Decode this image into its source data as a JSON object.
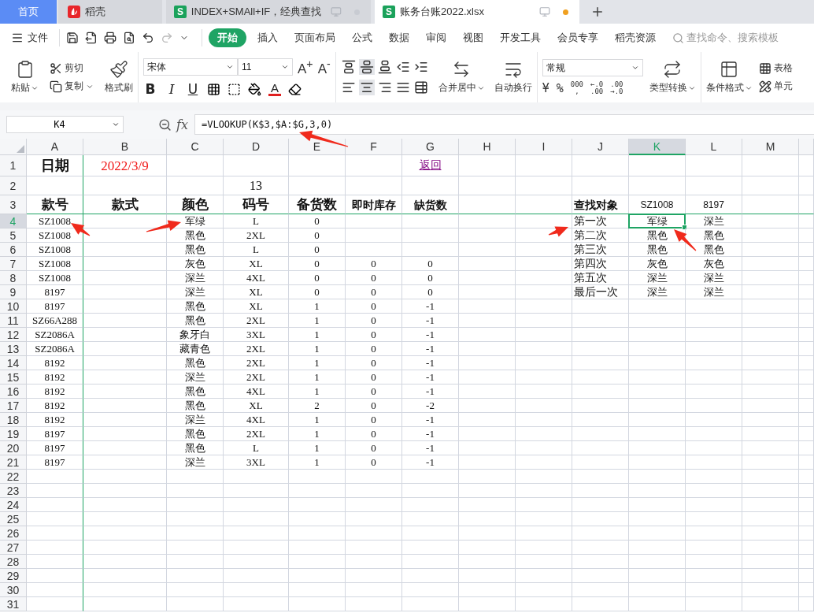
{
  "tabs": [
    {
      "kind": "home",
      "label": "首页",
      "selected": false
    },
    {
      "kind": "app",
      "label": "稻壳",
      "selected": false
    },
    {
      "kind": "doc",
      "icon_letter": "S",
      "label": "INDEX+SMAll+IF，经典查找",
      "selected": false,
      "unsaved": false
    },
    {
      "kind": "doc",
      "icon_letter": "S",
      "label": "账务台账2022.xlsx",
      "selected": true,
      "unsaved": true
    }
  ],
  "menu": {
    "file": "文件",
    "tabs": [
      {
        "label": "开始",
        "selected": true
      },
      {
        "label": "插入",
        "selected": false
      },
      {
        "label": "页面布局",
        "selected": false
      },
      {
        "label": "公式",
        "selected": false
      },
      {
        "label": "数据",
        "selected": false
      },
      {
        "label": "审阅",
        "selected": false
      },
      {
        "label": "视图",
        "selected": false
      },
      {
        "label": "开发工具",
        "selected": false
      },
      {
        "label": "会员专享",
        "selected": false
      },
      {
        "label": "稻壳资源",
        "selected": false
      }
    ],
    "search": {
      "placeholder": "查找命令、搜索模板"
    }
  },
  "ribbon": {
    "paste": "粘贴",
    "cut": "剪切",
    "copy": "复制",
    "painter": "格式刷",
    "font": "宋体",
    "size": "11",
    "grow": "A$^{+}$",
    "shrink": "A$^{-}$",
    "styles": [
      {
        "kind": "bold",
        "label": "B"
      },
      {
        "kind": "italic",
        "label": "I"
      },
      {
        "kind": "underline",
        "label": "U"
      }
    ],
    "font_color": "A",
    "merge": "合并居中",
    "wrap": "自动换行",
    "number_format": "常规",
    "number_buttons": [
      {
        "kind": "single",
        "lines": [
          "¥"
        ]
      },
      {
        "kind": "single",
        "lines": [
          "%"
        ]
      },
      {
        "kind": "stack",
        "lines": [
          "000",
          ","
        ]
      },
      {
        "kind": "stack",
        "lines": [
          "←.0",
          ".00"
        ]
      },
      {
        "kind": "stack",
        "lines": [
          ".00",
          "→.0"
        ]
      }
    ],
    "convert": "类型转换",
    "conditional": "条件格式",
    "table_style": "表格",
    "cell_style": "单元"
  },
  "formula_bar": {
    "name_box": "K4",
    "fx": "fx",
    "formula": "=VLOOKUP(K$3,$A:$G,3,0)"
  },
  "sheet": {
    "columns": [
      {
        "label": "A",
        "selected": false
      },
      {
        "label": "B",
        "selected": false
      },
      {
        "label": "C",
        "selected": false
      },
      {
        "label": "D",
        "selected": false
      },
      {
        "label": "E",
        "selected": false
      },
      {
        "label": "F",
        "selected": false
      },
      {
        "label": "G",
        "selected": false
      },
      {
        "label": "H",
        "selected": false
      },
      {
        "label": "I",
        "selected": false
      },
      {
        "label": "J",
        "selected": false
      },
      {
        "label": "K",
        "selected": true
      },
      {
        "label": "L",
        "selected": false
      },
      {
        "label": "M",
        "selected": false
      }
    ],
    "rows": [
      {
        "label": "1",
        "selected": false,
        "cells": {
          "A": {
            "text": "日期",
            "kind": "title"
          },
          "B": {
            "text": "2022/3/9",
            "kind": "date"
          },
          "G": {
            "text": "返回",
            "kind": "link"
          }
        }
      },
      {
        "label": "2",
        "selected": false,
        "cells": {
          "D": {
            "text": "13",
            "kind": "large"
          }
        }
      },
      {
        "label": "3",
        "selected": false,
        "cells": {
          "A": {
            "text": "款号",
            "kind": "header"
          },
          "B": {
            "text": "款式",
            "kind": "header"
          },
          "C": {
            "text": "颜色",
            "kind": "header"
          },
          "D": {
            "text": "码号",
            "kind": "header"
          },
          "E": {
            "text": "备货数",
            "kind": "header"
          },
          "F": {
            "text": "即时库存",
            "kind": "header-small"
          },
          "G": {
            "text": "缺货数",
            "kind": "header-small"
          },
          "J": {
            "text": "查找对象",
            "kind": "label"
          },
          "K": {
            "text": "SZ1008",
            "kind": "sans"
          },
          "L": {
            "text": "8197",
            "kind": "sans"
          }
        }
      },
      {
        "label": "4",
        "selected": true,
        "cells": {
          "A": {
            "text": "SZ1008",
            "kind": "plain"
          },
          "C": {
            "text": "军绿",
            "kind": "plain"
          },
          "D": {
            "text": "L",
            "kind": "plain"
          },
          "E": {
            "text": "0",
            "kind": "plain"
          },
          "J": {
            "text": "第一次",
            "kind": "left"
          },
          "K": {
            "text": "军绿",
            "kind": "plain"
          },
          "L": {
            "text": "深兰",
            "kind": "plain"
          }
        }
      },
      {
        "label": "5",
        "selected": false,
        "cells": {
          "A": {
            "text": "SZ1008",
            "kind": "plain"
          },
          "C": {
            "text": "黑色",
            "kind": "plain"
          },
          "D": {
            "text": "2XL",
            "kind": "plain"
          },
          "E": {
            "text": "0",
            "kind": "plain"
          },
          "J": {
            "text": "第二次",
            "kind": "left"
          },
          "K": {
            "text": "黑色",
            "kind": "plain"
          },
          "L": {
            "text": "黑色",
            "kind": "plain"
          }
        }
      },
      {
        "label": "6",
        "selected": false,
        "cells": {
          "A": {
            "text": "SZ1008",
            "kind": "plain"
          },
          "C": {
            "text": "黑色",
            "kind": "plain"
          },
          "D": {
            "text": "L",
            "kind": "plain"
          },
          "E": {
            "text": "0",
            "kind": "plain"
          },
          "J": {
            "text": "第三次",
            "kind": "left"
          },
          "K": {
            "text": "黑色",
            "kind": "plain"
          },
          "L": {
            "text": "黑色",
            "kind": "plain"
          }
        }
      },
      {
        "label": "7",
        "selected": false,
        "cells": {
          "A": {
            "text": "SZ1008",
            "kind": "plain"
          },
          "C": {
            "text": "灰色",
            "kind": "plain"
          },
          "D": {
            "text": "XL",
            "kind": "plain"
          },
          "E": {
            "text": "0",
            "kind": "plain"
          },
          "F": {
            "text": "0",
            "kind": "plain"
          },
          "G": {
            "text": "0",
            "kind": "plain"
          },
          "J": {
            "text": "第四次",
            "kind": "left"
          },
          "K": {
            "text": "灰色",
            "kind": "plain"
          },
          "L": {
            "text": "灰色",
            "kind": "plain"
          }
        }
      },
      {
        "label": "8",
        "selected": false,
        "cells": {
          "A": {
            "text": "SZ1008",
            "kind": "plain"
          },
          "C": {
            "text": "深兰",
            "kind": "plain"
          },
          "D": {
            "text": "4XL",
            "kind": "plain"
          },
          "E": {
            "text": "0",
            "kind": "plain"
          },
          "F": {
            "text": "0",
            "kind": "plain"
          },
          "G": {
            "text": "0",
            "kind": "plain"
          },
          "J": {
            "text": "第五次",
            "kind": "left"
          },
          "K": {
            "text": "深兰",
            "kind": "plain"
          },
          "L": {
            "text": "深兰",
            "kind": "plain"
          }
        }
      },
      {
        "label": "9",
        "selected": false,
        "cells": {
          "A": {
            "text": "8197",
            "kind": "plain"
          },
          "C": {
            "text": "深兰",
            "kind": "plain"
          },
          "D": {
            "text": "XL",
            "kind": "plain"
          },
          "E": {
            "text": "0",
            "kind": "plain"
          },
          "F": {
            "text": "0",
            "kind": "plain"
          },
          "G": {
            "text": "0",
            "kind": "plain"
          },
          "J": {
            "text": "最后一次",
            "kind": "left"
          },
          "K": {
            "text": "深兰",
            "kind": "plain"
          },
          "L": {
            "text": "深兰",
            "kind": "plain"
          }
        }
      },
      {
        "label": "10",
        "selected": false,
        "cells": {
          "A": {
            "text": "8197",
            "kind": "plain"
          },
          "C": {
            "text": "黑色",
            "kind": "plain"
          },
          "D": {
            "text": "XL",
            "kind": "plain"
          },
          "E": {
            "text": "1",
            "kind": "plain"
          },
          "F": {
            "text": "0",
            "kind": "plain"
          },
          "G": {
            "text": "-1",
            "kind": "plain"
          }
        }
      },
      {
        "label": "11",
        "selected": false,
        "cells": {
          "A": {
            "text": "SZ66A288",
            "kind": "plain"
          },
          "C": {
            "text": "黑色",
            "kind": "plain"
          },
          "D": {
            "text": "2XL",
            "kind": "plain"
          },
          "E": {
            "text": "1",
            "kind": "plain"
          },
          "F": {
            "text": "0",
            "kind": "plain"
          },
          "G": {
            "text": "-1",
            "kind": "plain"
          }
        }
      },
      {
        "label": "12",
        "selected": false,
        "cells": {
          "A": {
            "text": "SZ2086A",
            "kind": "plain"
          },
          "C": {
            "text": "象牙白",
            "kind": "plain"
          },
          "D": {
            "text": "3XL",
            "kind": "plain"
          },
          "E": {
            "text": "1",
            "kind": "plain"
          },
          "F": {
            "text": "0",
            "kind": "plain"
          },
          "G": {
            "text": "-1",
            "kind": "plain"
          }
        }
      },
      {
        "label": "13",
        "selected": false,
        "cells": {
          "A": {
            "text": "SZ2086A",
            "kind": "plain"
          },
          "C": {
            "text": "藏青色",
            "kind": "plain"
          },
          "D": {
            "text": "2XL",
            "kind": "plain"
          },
          "E": {
            "text": "1",
            "kind": "plain"
          },
          "F": {
            "text": "0",
            "kind": "plain"
          },
          "G": {
            "text": "-1",
            "kind": "plain"
          }
        }
      },
      {
        "label": "14",
        "selected": false,
        "cells": {
          "A": {
            "text": "8192",
            "kind": "plain"
          },
          "C": {
            "text": "黑色",
            "kind": "plain"
          },
          "D": {
            "text": "2XL",
            "kind": "plain"
          },
          "E": {
            "text": "1",
            "kind": "plain"
          },
          "F": {
            "text": "0",
            "kind": "plain"
          },
          "G": {
            "text": "-1",
            "kind": "plain"
          }
        }
      },
      {
        "label": "15",
        "selected": false,
        "cells": {
          "A": {
            "text": "8192",
            "kind": "plain"
          },
          "C": {
            "text": "深兰",
            "kind": "plain"
          },
          "D": {
            "text": "2XL",
            "kind": "plain"
          },
          "E": {
            "text": "1",
            "kind": "plain"
          },
          "F": {
            "text": "0",
            "kind": "plain"
          },
          "G": {
            "text": "-1",
            "kind": "plain"
          }
        }
      },
      {
        "label": "16",
        "selected": false,
        "cells": {
          "A": {
            "text": "8192",
            "kind": "plain"
          },
          "C": {
            "text": "黑色",
            "kind": "plain"
          },
          "D": {
            "text": "4XL",
            "kind": "plain"
          },
          "E": {
            "text": "1",
            "kind": "plain"
          },
          "F": {
            "text": "0",
            "kind": "plain"
          },
          "G": {
            "text": "-1",
            "kind": "plain"
          }
        }
      },
      {
        "label": "17",
        "selected": false,
        "cells": {
          "A": {
            "text": "8192",
            "kind": "plain"
          },
          "C": {
            "text": "黑色",
            "kind": "plain"
          },
          "D": {
            "text": "XL",
            "kind": "plain"
          },
          "E": {
            "text": "2",
            "kind": "plain"
          },
          "F": {
            "text": "0",
            "kind": "plain"
          },
          "G": {
            "text": "-2",
            "kind": "plain"
          }
        }
      },
      {
        "label": "18",
        "selected": false,
        "cells": {
          "A": {
            "text": "8192",
            "kind": "plain"
          },
          "C": {
            "text": "深兰",
            "kind": "plain"
          },
          "D": {
            "text": "4XL",
            "kind": "plain"
          },
          "E": {
            "text": "1",
            "kind": "plain"
          },
          "F": {
            "text": "0",
            "kind": "plain"
          },
          "G": {
            "text": "-1",
            "kind": "plain"
          }
        }
      },
      {
        "label": "19",
        "selected": false,
        "cells": {
          "A": {
            "text": "8197",
            "kind": "plain"
          },
          "C": {
            "text": "黑色",
            "kind": "plain"
          },
          "D": {
            "text": "2XL",
            "kind": "plain"
          },
          "E": {
            "text": "1",
            "kind": "plain"
          },
          "F": {
            "text": "0",
            "kind": "plain"
          },
          "G": {
            "text": "-1",
            "kind": "plain"
          }
        }
      },
      {
        "label": "20",
        "selected": false,
        "cells": {
          "A": {
            "text": "8197",
            "kind": "plain"
          },
          "C": {
            "text": "黑色",
            "kind": "plain"
          },
          "D": {
            "text": "L",
            "kind": "plain"
          },
          "E": {
            "text": "1",
            "kind": "plain"
          },
          "F": {
            "text": "0",
            "kind": "plain"
          },
          "G": {
            "text": "-1",
            "kind": "plain"
          }
        }
      },
      {
        "label": "21",
        "selected": false,
        "cells": {
          "A": {
            "text": "8197",
            "kind": "plain"
          },
          "C": {
            "text": "深兰",
            "kind": "plain"
          },
          "D": {
            "text": "3XL",
            "kind": "plain"
          },
          "E": {
            "text": "1",
            "kind": "plain"
          },
          "F": {
            "text": "0",
            "kind": "plain"
          },
          "G": {
            "text": "-1",
            "kind": "plain"
          }
        }
      },
      {
        "label": "22",
        "selected": false
      },
      {
        "label": "23",
        "selected": false
      },
      {
        "label": "24",
        "selected": false
      },
      {
        "label": "25",
        "selected": false
      },
      {
        "label": "26",
        "selected": false
      },
      {
        "label": "27",
        "selected": false
      },
      {
        "label": "28",
        "selected": false
      },
      {
        "label": "29",
        "selected": false
      },
      {
        "label": "30",
        "selected": false
      },
      {
        "label": "31",
        "selected": false
      }
    ]
  }
}
